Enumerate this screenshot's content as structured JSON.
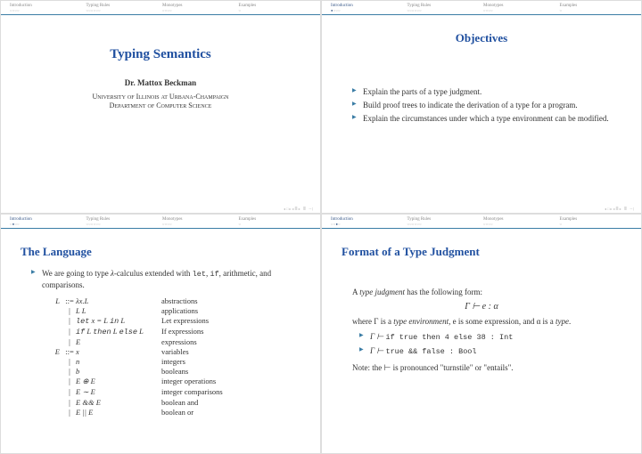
{
  "nav": {
    "items": [
      "Introduction",
      "Typing Rules",
      "Monotypes",
      "Examples"
    ],
    "dots": [
      "○○○○",
      "○○○○○○",
      "○○○○",
      "○"
    ],
    "dots_intro_active": "●○○○",
    "dots_intro_active2": "○●○○"
  },
  "slide1": {
    "title": "Typing Semantics",
    "author": "Dr. Mattox Beckman",
    "affil1": "University of Illinois at Urbana-Champaign",
    "affil2": "Department of Computer Science"
  },
  "slide2": {
    "title": "Objectives",
    "bullets": [
      "Explain the parts of a type judgment.",
      "Build proof trees to indicate the derivation of a type for a program.",
      "Explain the circumstances under which a type environment can be modified."
    ]
  },
  "slide3": {
    "title": "The Language",
    "intro_a": "We are going to type ",
    "intro_b": "-calculus extended with ",
    "intro_c": ", arithmetic, and comparisons.",
    "lambda": "λ",
    "tt1": "let",
    "tt2": "if",
    "grammar": [
      {
        "l": "L",
        "m": "::=",
        "r": "λx.L",
        "d": "abstractions"
      },
      {
        "l": "",
        "m": "|",
        "r": "L L",
        "d": "applications"
      },
      {
        "l": "",
        "m": "|",
        "r": "let x = L in L",
        "d": "Let expressions",
        "tt": [
          "let",
          "in"
        ]
      },
      {
        "l": "",
        "m": "|",
        "r": "if L then L else L",
        "d": "If expressions",
        "tt": [
          "if",
          "then",
          "else"
        ]
      },
      {
        "l": "",
        "m": "|",
        "r": "E",
        "d": "expressions"
      },
      {
        "l": "E",
        "m": "::=",
        "r": "x",
        "d": "variables"
      },
      {
        "l": "",
        "m": "|",
        "r": "n",
        "d": "integers"
      },
      {
        "l": "",
        "m": "|",
        "r": "b",
        "d": "booleans"
      },
      {
        "l": "",
        "m": "|",
        "r": "E ⊕ E",
        "d": "integer operations"
      },
      {
        "l": "",
        "m": "|",
        "r": "E ∼ E",
        "d": "integer comparisons"
      },
      {
        "l": "",
        "m": "|",
        "r": "E && E",
        "d": "boolean and"
      },
      {
        "l": "",
        "m": "|",
        "r": "E || E",
        "d": "boolean or"
      }
    ]
  },
  "slide4": {
    "title": "Format of a Type Judgment",
    "p1a": "A ",
    "p1b": "type judgment",
    "p1c": " has the following form:",
    "judgment": "Γ ⊢ e : α",
    "p2a": "where Γ is a ",
    "p2b": "type environment",
    "p2c": ", e is some expression, and α is a ",
    "p2d": "type",
    "p2e": ".",
    "ex1_a": "Γ ⊢ ",
    "ex1_b": "if true then 4 else 38",
    "ex1_c": " : Int",
    "ex2_a": "Γ ⊢ ",
    "ex2_b": "true && false ",
    "ex2_c": " : Bool",
    "note": "Note: the ⊢ is pronounced \"turnstile\" or \"entails\"."
  }
}
